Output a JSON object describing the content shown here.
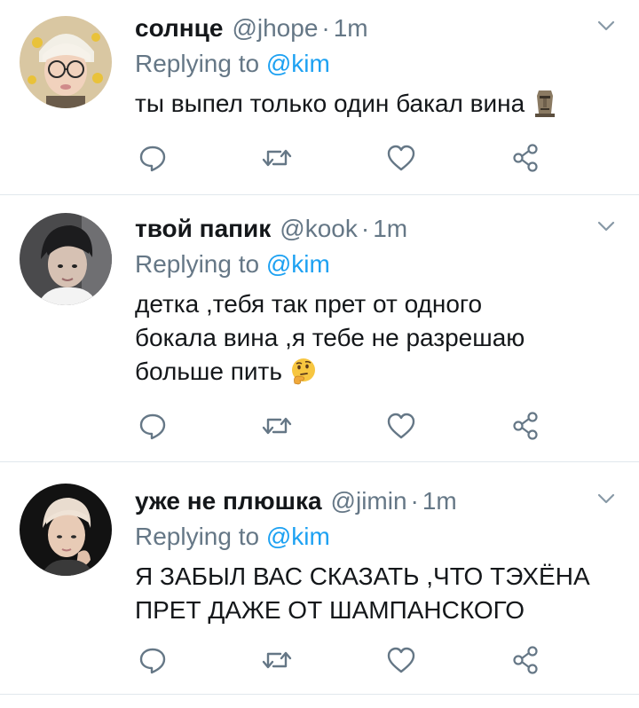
{
  "colors": {
    "link": "#1da1f2",
    "muted": "#657786",
    "text": "#14171a",
    "divider": "#e1e8ed"
  },
  "reply_prefix": "Replying to",
  "tweets": [
    {
      "name": "солнце",
      "handle": "@jhope",
      "sep": "·",
      "time": "1m",
      "reply_to": "@kim",
      "text": "ты выпел только один бакал вина",
      "emoji": "moai-icon"
    },
    {
      "name": "твой папик",
      "handle": "@kook",
      "sep": "·",
      "time": "1m",
      "reply_to": "@kim",
      "text_lines": [
        "детка ,тебя так прет от одного",
        "бокала вина ,я тебе не разрешаю",
        "больше пить"
      ],
      "emoji": "thinking-face-icon"
    },
    {
      "name": "уже не плюшка",
      "handle": "@jimin",
      "sep": "·",
      "time": "1m",
      "reply_to": "@kim",
      "text_lines": [
        "Я ЗАБЫЛ ВАС СКАЗАТЬ ,ЧТО ТЭХЁНА",
        "ПРЕТ ДАЖЕ ОТ ШАМПАНСКОГО"
      ]
    }
  ]
}
